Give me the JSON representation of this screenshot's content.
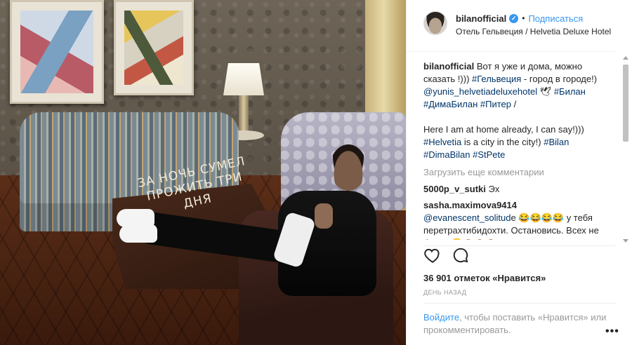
{
  "photo": {
    "table_text_line1": "ЗА НОЧЬ СУМЕЛ",
    "table_text_line2": "ПРОЖИТЬ ТРИ",
    "table_text_line3": "ДНЯ"
  },
  "header": {
    "username": "bilanofficial",
    "verified_mark": "✓",
    "separator": "•",
    "follow_label": "Подписаться",
    "location": "Отель Гельвеция / Helvetia Deluxe Hotel"
  },
  "caption": {
    "author": "bilanofficial",
    "text1": "Вот я уже и дома, можно сказать !))) ",
    "tag1": "#Гельвеция",
    "text2": " - город в городе!) ",
    "mention1": "@yunis_helvetiadeluxehotel",
    "text3": " 🕊 ",
    "tag2": "#Билан",
    "tag3": "#ДимаБилан",
    "text4": " ",
    "tag4": "#Питер",
    "text5": " /",
    "en_text1": "Here I am at home already, I can say!))) ",
    "tag5": "#Helvetia",
    "en_text2": " is a city in the city!) ",
    "tag6": "#Bilan",
    "tag7": "#DimaBilan",
    "tag8": "#StPete"
  },
  "load_more": "Загрузить еще комментарии",
  "comments": [
    {
      "user": "5000p_v_sutki",
      "text": " Эх"
    },
    {
      "user": "sasha.maximova9414",
      "mention": "@evanescent_solitud",
      "text": "е 😂😂😂😂 у тебя перетрахтибидохти. Остановись. Всех не бери!! 😂🙈🙈🙈"
    }
  ],
  "icons": {
    "like": "heart-icon",
    "comment": "comment-icon",
    "more": "more-options-icon"
  },
  "likes": "36 901 отметок «Нравится»",
  "time_ago": "День назад",
  "login": {
    "link": "Войдите",
    "text": ", чтобы поставить «Нравится» или прокомментировать."
  },
  "more_label": "•••"
}
